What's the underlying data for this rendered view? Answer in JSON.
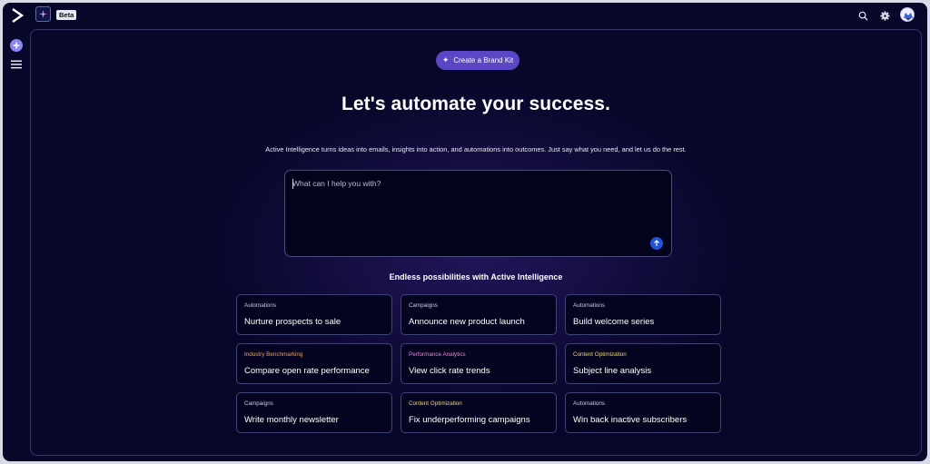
{
  "header": {
    "badge": "Beta",
    "icons": [
      "logo-chevron-icon",
      "app-sparkle-icon",
      "search-icon",
      "gear-icon",
      "avatar"
    ]
  },
  "sidebar": {
    "icons": [
      "plus-icon",
      "menu-icon"
    ]
  },
  "main": {
    "brand_kit_button": "Create a Brand Kit",
    "headline": "Let's automate your success.",
    "subtext": "Active Intelligence turns ideas into emails, insights into action, and automations into outcomes. Just say what you need, and let us do the rest.",
    "prompt": {
      "placeholder": "What can I help you with?",
      "value": ""
    },
    "section_title": "Endless possibilities with Active Intelligence",
    "cards": [
      {
        "category": "Automations",
        "title": "Nurture prospects to sale",
        "color": "#c9cce0"
      },
      {
        "category": "Campaigns",
        "title": "Announce new product launch",
        "color": "#c9cce0"
      },
      {
        "category": "Automations",
        "title": "Build welcome series",
        "color": "#c9cce0"
      },
      {
        "category": "Industry Benchmarking",
        "title": "Compare open rate performance",
        "color": "#f2a25a"
      },
      {
        "category": "Performance Analytics",
        "title": "View click rate trends",
        "color": "#e58ad6"
      },
      {
        "category": "Content Optimization",
        "title": "Subject line analysis",
        "color": "#f0d97a"
      },
      {
        "category": "Campaigns",
        "title": "Write monthly newsletter",
        "color": "#c9cce0"
      },
      {
        "category": "Content Optimization",
        "title": "Fix underperforming campaigns",
        "color": "#f0d97a"
      },
      {
        "category": "Automations",
        "title": "Win back inactive subscribers",
        "color": "#c9cce0"
      }
    ]
  },
  "colors": {
    "background": "#07072a",
    "accent_button": "#5b46c6",
    "send_button": "#2452d6",
    "rail_add": "#8b84f5"
  }
}
